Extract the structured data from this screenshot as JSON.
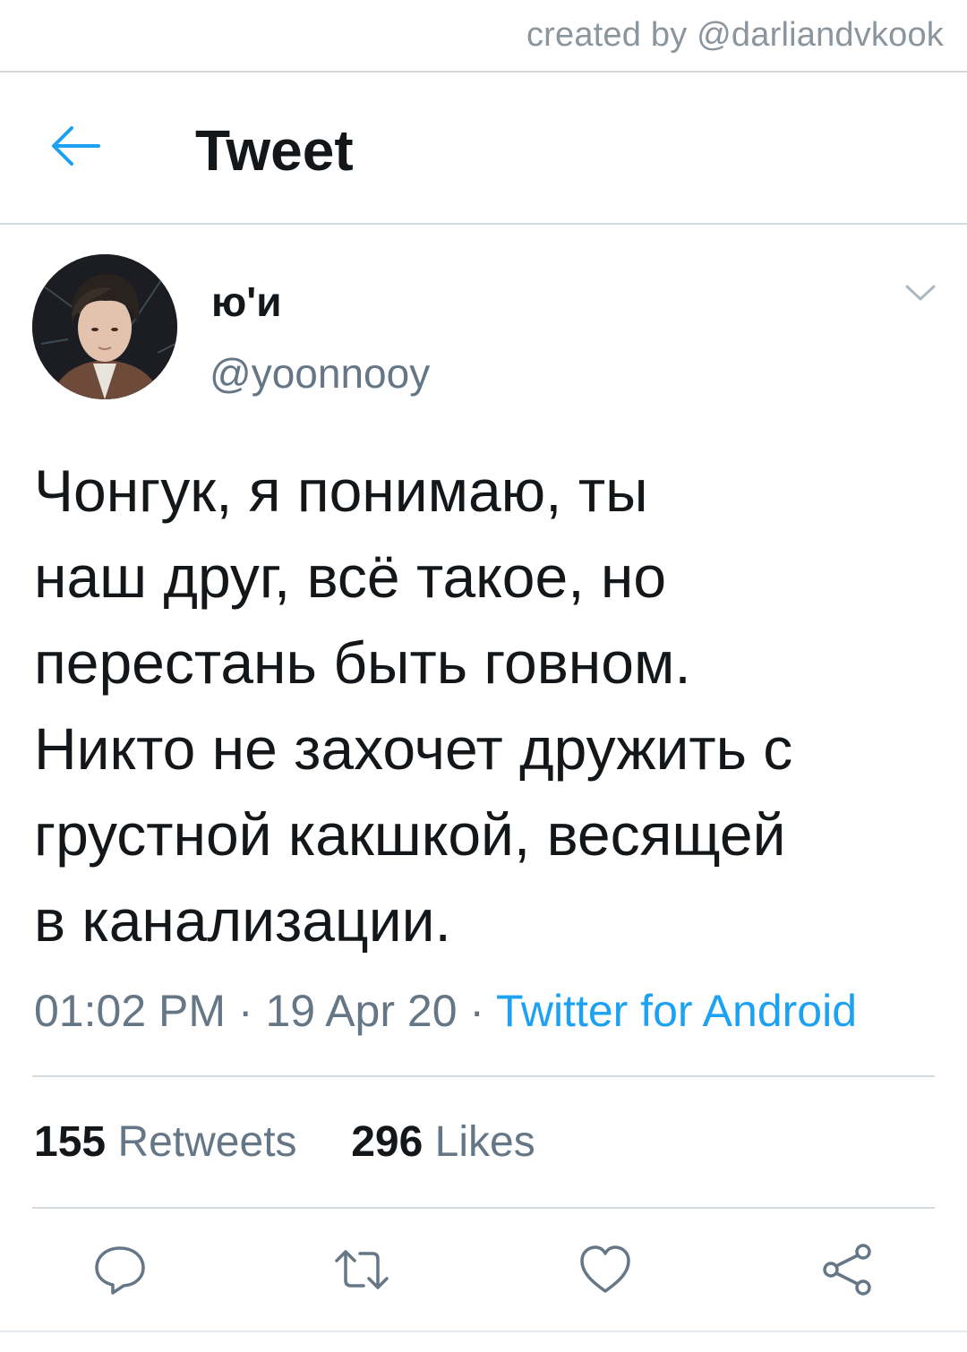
{
  "watermark": "created by @darliandvkook",
  "header": {
    "back_icon": "arrow-left-icon",
    "title": "Tweet"
  },
  "tweet": {
    "author": {
      "display_name": "ю'и",
      "handle": "@yoonnooy"
    },
    "more_icon": "chevron-down-icon",
    "text_lines": [
      "Чонгук, я понимаю, ты",
      "наш друг, всё такое, но",
      "перестань быть говном.",
      "Никто не захочет дружить с",
      "грустной какшкой, весящей",
      "в канализации."
    ],
    "time": "01:02 PM",
    "date": "19 Apr 20",
    "separator": " · ",
    "source": "Twitter for Android",
    "retweets": {
      "count": "155",
      "label": "Retweets"
    },
    "likes": {
      "count": "296",
      "label": "Likes"
    }
  },
  "actions": {
    "reply_icon": "reply-icon",
    "retweet_icon": "retweet-icon",
    "like_icon": "heart-icon",
    "share_icon": "share-icon"
  },
  "colors": {
    "accent": "#1da1f2",
    "text": "#14171a",
    "secondary": "#657786",
    "divider": "#d4dbe0"
  }
}
